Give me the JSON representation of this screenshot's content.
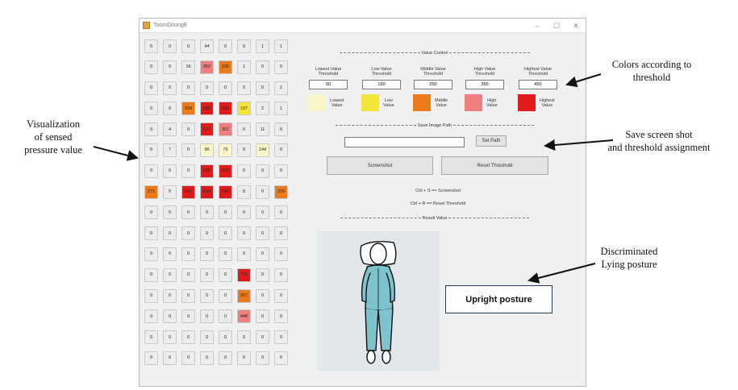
{
  "window": {
    "title": "ToomDoongE",
    "controls": [
      "–",
      "☐",
      "✕"
    ]
  },
  "pressure_grid": {
    "rows": [
      [
        "0",
        "0",
        "0",
        "44",
        "0",
        "0",
        "1",
        "1"
      ],
      [
        "0",
        "0",
        "16",
        "352",
        "336",
        "1",
        "0",
        "0"
      ],
      [
        "0",
        "0",
        "0",
        "0",
        "0",
        "0",
        "0",
        "1"
      ],
      [
        "0",
        "0",
        "334",
        "586",
        "490",
        "197",
        "2",
        "1"
      ],
      [
        "0",
        "4",
        "0",
        "517",
        "351",
        "0",
        "11",
        "0"
      ],
      [
        "0",
        "7",
        "0",
        "96",
        "79",
        "0",
        "144",
        "0"
      ],
      [
        "0",
        "0",
        "0",
        "505",
        "502",
        "0",
        "0",
        "0"
      ],
      [
        "271",
        "0",
        "592",
        "614",
        "580",
        "0",
        "0",
        "315"
      ],
      [
        "0",
        "0",
        "0",
        "0",
        "0",
        "0",
        "0",
        "0"
      ],
      [
        "0",
        "0",
        "0",
        "0",
        "0",
        "0",
        "0",
        "0"
      ],
      [
        "0",
        "0",
        "0",
        "0",
        "0",
        "0",
        "0",
        "0"
      ],
      [
        "0",
        "0",
        "0",
        "0",
        "0",
        "716",
        "0",
        "0"
      ],
      [
        "0",
        "0",
        "0",
        "0",
        "0",
        "257",
        "0",
        "0"
      ],
      [
        "0",
        "0",
        "0",
        "0",
        "0",
        "448",
        "0",
        "0"
      ],
      [
        "0",
        "0",
        "0",
        "0",
        "0",
        "0",
        "0",
        "0"
      ],
      [
        "0",
        "0",
        "0",
        "0",
        "0",
        "0",
        "0",
        "0"
      ]
    ]
  },
  "value_control": {
    "header": "Value Control",
    "thresholds": [
      {
        "label_line1": "Lowest Value",
        "label_line2": "Threshold",
        "value": "50",
        "swatch_line1": "Lowest",
        "swatch_line2": "Value",
        "color": "#fbf6c8"
      },
      {
        "label_line1": "Low Value",
        "label_line2": "Threshold",
        "value": "150",
        "swatch_line1": "Low",
        "swatch_line2": "Value",
        "color": "#f3e63a"
      },
      {
        "label_line1": "Middle Value",
        "label_line2": "Threshold",
        "value": "250",
        "swatch_line1": "Middle",
        "swatch_line2": "Value",
        "color": "#ec7a1b"
      },
      {
        "label_line1": "High Value",
        "label_line2": "Threshold",
        "value": "350",
        "swatch_line1": "High",
        "swatch_line2": "Value",
        "color": "#f08080"
      },
      {
        "label_line1": "Highest Value",
        "label_line2": "Threshold",
        "value": "450",
        "swatch_line1": "Highest",
        "swatch_line2": "Value",
        "color": "#e11b1b"
      }
    ]
  },
  "save_path": {
    "header": "Save Image Path",
    "input_value": "",
    "set_path_label": "Set Path",
    "screenshot_label": "Screenshot",
    "reset_label": "Reset Threshold",
    "hint_screenshot": "Ctrl + S == Screenshot",
    "hint_reset": "Ctrl + R == Reset Threshold"
  },
  "result": {
    "header": "Result Value",
    "posture": "Upright posture"
  },
  "annotations": {
    "colors_1": "Colors according to",
    "colors_2": "threshold",
    "vis_1": "Visualization",
    "vis_2": "of sensed",
    "vis_3": "pressure value",
    "save_1": "Save screen shot",
    "save_2": "and threshold assignment",
    "disc_1": "Discriminated",
    "disc_2": "Lying posture"
  },
  "colors": {
    "empty_cell": "#ececec",
    "lowest": "#fbf6c8",
    "low": "#f3e63a",
    "middle": "#ec7a1b",
    "high": "#f08080",
    "highest": "#e11b1b",
    "pajama": "#7fc3cf"
  }
}
